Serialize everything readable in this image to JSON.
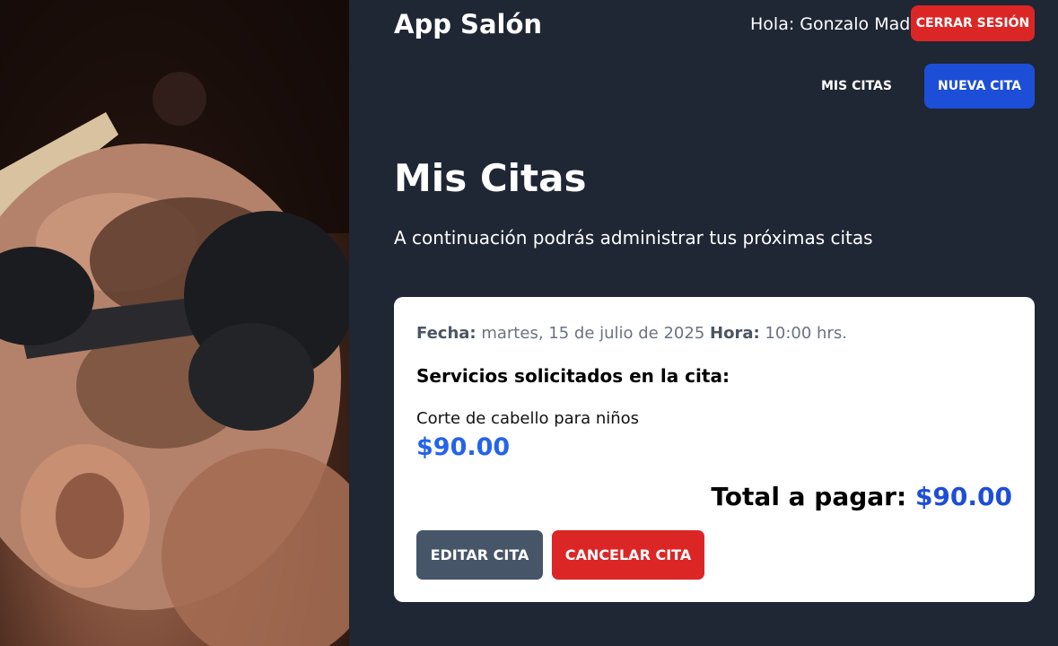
{
  "header": {
    "app_name": "App Salón",
    "greeting": "Hola: Gonzalo Mad",
    "logout_label": "CERRAR SESIÓN"
  },
  "nav": {
    "my_appointments_label": "MIS CITAS",
    "new_appointment_label": "NUEVA CITA"
  },
  "main": {
    "title": "Mis Citas",
    "description": "A continuación podrás administrar tus próximas citas"
  },
  "appointment": {
    "date_label": "Fecha:",
    "date_value": "martes, 15 de julio de 2025",
    "time_label": "Hora:",
    "time_value": "10:00 hrs.",
    "services_title": "Servicios solicitados en la cita:",
    "services": [
      {
        "name": "Corte de cabello para niños",
        "price": "$90.00"
      }
    ],
    "total_label": "Total a pagar:",
    "total_value": "$90.00",
    "edit_label": "EDITAR CITA",
    "cancel_label": "CANCELAR CITA"
  },
  "colors": {
    "background": "#1f2634",
    "primary_blue": "#1d4ed8",
    "danger_red": "#dc2626",
    "slate_button": "#475569",
    "price_blue": "#2563eb"
  }
}
